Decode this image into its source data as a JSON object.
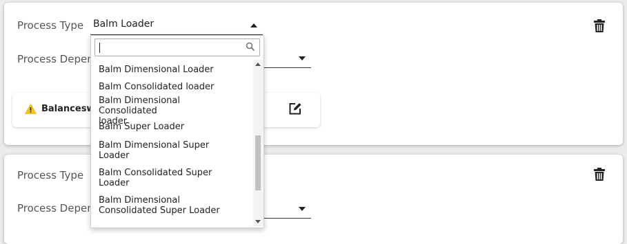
{
  "processes": [
    {
      "process_type_label": "Process Type",
      "process_type_value": "Balm Loader",
      "process_dependency_label": "Process Dependency",
      "item": {
        "name": "Balancesw"
      }
    },
    {
      "process_type_label": "Process Type",
      "process_dependency_label": "Process Dependency"
    }
  ],
  "dropdown": {
    "search_value": "",
    "options": [
      "Balm Dimensional Loader",
      "Balm Consolidated loader",
      "Balm Dimensional Consolidated loader",
      "Balm Super Loader",
      "Balm Dimensional Super Loader",
      "Balm Consolidated Super Loader",
      "Balm Dimensional Consolidated Super Loader"
    ]
  },
  "icons": {
    "delete": "trash-icon",
    "edit": "edit-icon",
    "warning": "warning-icon",
    "search": "search-icon"
  },
  "colors": {
    "warning": "#f5c518"
  }
}
